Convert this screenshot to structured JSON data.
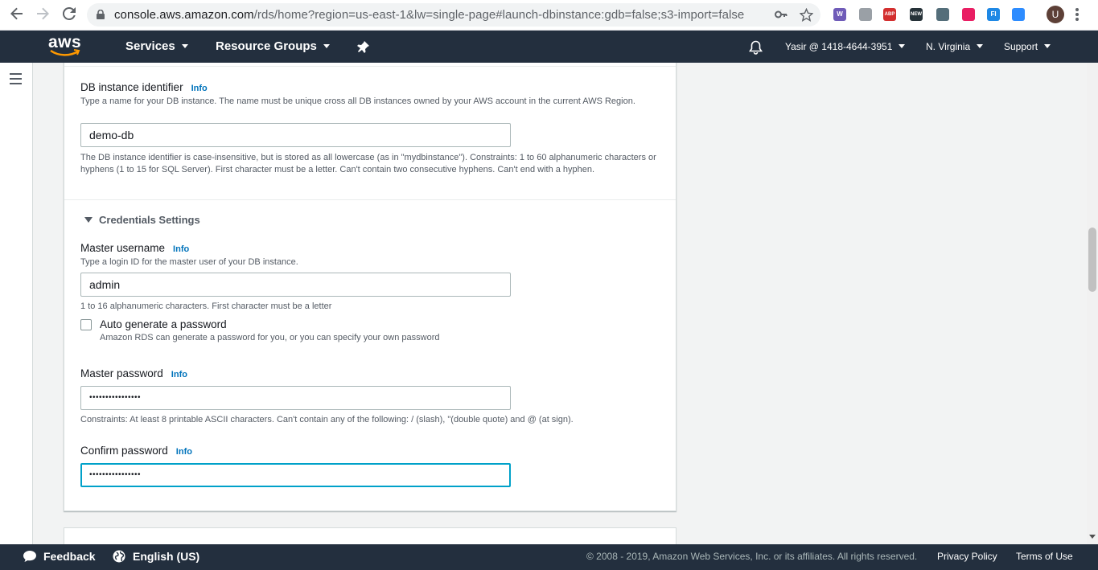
{
  "browser": {
    "url_host": "console.aws.amazon.com",
    "url_rest": "/rds/home?region=us-east-1&lw=single-page#launch-dbinstance:gdb=false;s3-import=false",
    "avatar_letter": "U",
    "extensions": [
      {
        "name": "wappalyzer-extension-icon",
        "color": "#6f5bb8",
        "text": "W"
      },
      {
        "name": "puzzle-extension-icon",
        "color": "#9aa0a6",
        "text": ""
      },
      {
        "name": "adblock-extension-icon",
        "color": "#d32f2f",
        "text": "ABP"
      },
      {
        "name": "news-extension-icon",
        "color": "#263238",
        "text": "NEW"
      },
      {
        "name": "eyedropper-extension-icon",
        "color": "#546e7a",
        "text": ""
      },
      {
        "name": "color-wheel-extension-icon",
        "color": "#e91e63",
        "text": ""
      },
      {
        "name": "fi-extension-icon",
        "color": "#1e88e5",
        "text": "FI"
      },
      {
        "name": "zoom-extension-icon",
        "color": "#2d8cff",
        "text": ""
      }
    ]
  },
  "aws_nav": {
    "logo": "aws",
    "services": "Services",
    "resource_groups": "Resource Groups",
    "account": "Yasir @ 1418-4644-3951",
    "region": "N. Virginia",
    "support": "Support"
  },
  "form": {
    "db_identifier": {
      "label": "DB instance identifier",
      "info": "Info",
      "description": "Type a name for your DB instance. The name must be unique cross all DB instances owned by your AWS account in the current AWS Region.",
      "value": "demo-db",
      "constraint": "The DB instance identifier is case-insensitive, but is stored as all lowercase (as in \"mydbinstance\"). Constraints: 1 to 60 alphanumeric characters or hyphens (1 to 15 for SQL Server). First character must be a letter. Can't contain two consecutive hyphens. Can't end with a hyphen."
    },
    "credentials_heading": "Credentials Settings",
    "master_username": {
      "label": "Master username",
      "info": "Info",
      "description": "Type a login ID for the master user of your DB instance.",
      "value": "admin",
      "constraint": "1 to 16 alphanumeric characters. First character must be a letter"
    },
    "auto_generate": {
      "label": "Auto generate a password",
      "description": "Amazon RDS can generate a password for you, or you can specify your own password",
      "checked": false
    },
    "master_password": {
      "label": "Master password",
      "info": "Info",
      "value": "••••••••••••••••",
      "constraint": "Constraints: At least 8 printable ASCII characters. Can't contain any of the following: / (slash), \"(double quote) and @ (at sign)."
    },
    "confirm_password": {
      "label": "Confirm password",
      "info": "Info",
      "value": "••••••••••••••••"
    }
  },
  "footer": {
    "feedback": "Feedback",
    "language": "English (US)",
    "copyright": "© 2008 - 2019, Amazon Web Services, Inc. or its affiliates. All rights reserved.",
    "privacy": "Privacy Policy",
    "terms": "Terms of Use"
  }
}
